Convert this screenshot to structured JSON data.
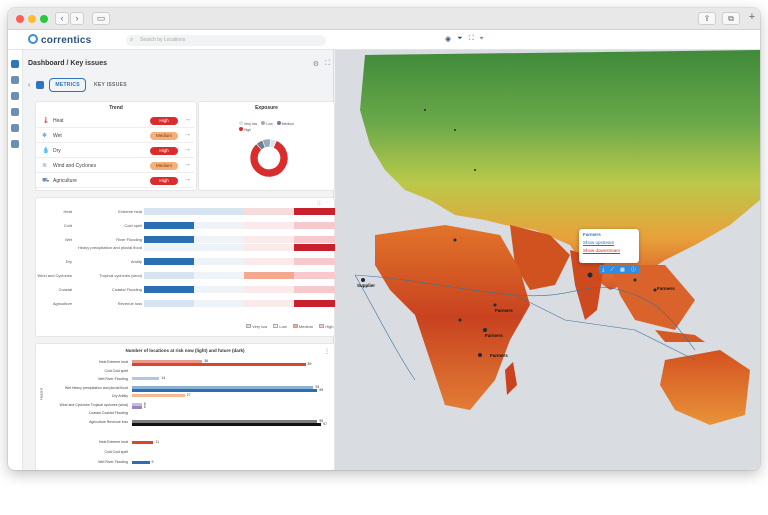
{
  "app": {
    "brand": "correntics",
    "search_placeholder": "Search by Locations"
  },
  "colors": {
    "high": "#d92d2d",
    "medium": "#f5b07a",
    "low": "#2a6fb1",
    "very_low": "#d6e4f1"
  },
  "panel": {
    "title": "Dashboard / Key issues",
    "tabs": [
      {
        "label": "METRICS",
        "active": true
      },
      {
        "label": "KEY ISSUES",
        "active": false
      }
    ]
  },
  "trend": {
    "title": "Trend",
    "rows": [
      {
        "icon": "thermometer-icon",
        "label": "Heat",
        "level": "High"
      },
      {
        "icon": "snowflake-icon",
        "label": "Wet",
        "level": "Medium"
      },
      {
        "icon": "drop-icon",
        "label": "Dry",
        "level": "High"
      },
      {
        "icon": "wind-icon",
        "label": "Wind and Cyclones",
        "level": "Medium"
      },
      {
        "icon": "tractor-icon",
        "label": "Agriculture",
        "level": "High"
      }
    ]
  },
  "exposure": {
    "title": "Exposure",
    "legend": [
      "Very low",
      "Low",
      "Medium",
      "High"
    ],
    "chart_data": {
      "type": "pie",
      "categories": [
        "High",
        "Medium",
        "Low",
        "Very low"
      ],
      "values": [
        82,
        6,
        7,
        5
      ]
    }
  },
  "hazard_matrix": {
    "rows": [
      {
        "group": "Heat",
        "label": "Extreme heat"
      },
      {
        "group": "Cold",
        "label": "Cold spell"
      },
      {
        "group": "Wet",
        "label": "River Flooding"
      },
      {
        "group": "",
        "label": "Heavy precipitation and pluvial flood"
      },
      {
        "group": "Dry",
        "label": "Aridity"
      },
      {
        "group": "Wind and Cyclones",
        "label": "Tropical cyclones (wind)"
      },
      {
        "group": "Coastal",
        "label": "Coastal Flooding"
      },
      {
        "group": "Agriculture",
        "label": "Revenue loss"
      }
    ],
    "legend": [
      "Very low",
      "Low",
      "Medium",
      "High"
    ]
  },
  "locations_chart": {
    "title": "Number of locations at risk now (light) and future (dark)",
    "ylabel": "Hazard",
    "chart_data": {
      "type": "bar",
      "categories": [
        "Heat Extreme heat",
        "Cold Cold spell",
        "Wet River Flooding",
        "Wet Heavy precipitation and pluvial flood",
        "Dry Aridity",
        "Wind and Cyclones Tropical cyclones (wind)",
        "Coastal Coastal Flooding",
        "Agriculture Revenue loss"
      ],
      "series": [
        {
          "name": "now",
          "values": [
            36,
            0,
            14,
            93,
            27,
            5,
            0,
            95
          ]
        },
        {
          "name": "future",
          "values": [
            89,
            0,
            0,
            95,
            0,
            5,
            0,
            97
          ]
        }
      ]
    },
    "value_labels": [
      "36",
      "89",
      "0",
      "14",
      "93",
      "95",
      "27",
      "5",
      "5",
      "95",
      "97"
    ],
    "second_block_labels": [
      "Heat Extreme heat",
      "Cold Cold spell",
      "Wet River Flooding"
    ],
    "second_block_values": [
      "11",
      "",
      "9"
    ]
  },
  "map": {
    "popup": {
      "title": "Farmers",
      "link1": "Show upstream",
      "link2": "Show downstream"
    },
    "labels": [
      "Supplier",
      "Farmers",
      "Farmers",
      "Farmers",
      "Farmers"
    ]
  }
}
